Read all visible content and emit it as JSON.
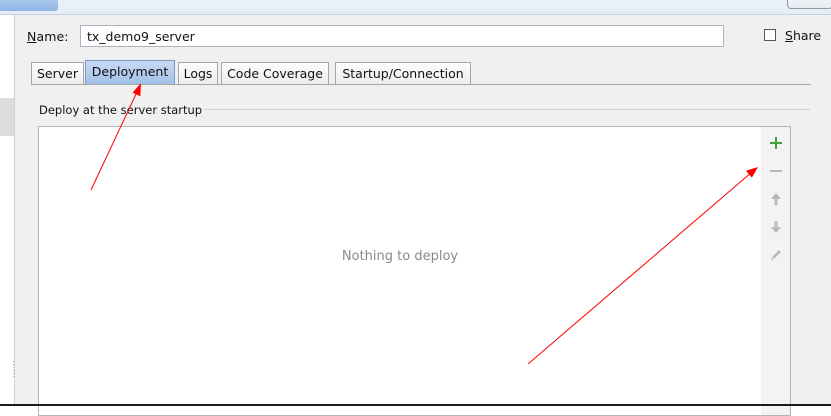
{
  "form": {
    "name_label_mnemonic": "N",
    "name_label_rest": "ame:",
    "name_value": "tx_demo9_server",
    "share_label_mnemonic": "S",
    "share_label_rest": "hare",
    "share_checked": false
  },
  "tabs": [
    {
      "label": "Server",
      "active": false
    },
    {
      "label": "Deployment",
      "active": true
    },
    {
      "label": "Logs",
      "active": false
    },
    {
      "label": "Code Coverage",
      "active": false
    },
    {
      "label": "Startup/Connection",
      "active": false
    }
  ],
  "deploy": {
    "section_title": "Deploy at the server startup",
    "empty_text": "Nothing to deploy",
    "toolbar": [
      {
        "icon": "plus-icon",
        "enabled": true
      },
      {
        "icon": "minus-icon",
        "enabled": false
      },
      {
        "icon": "arrow-up-icon",
        "enabled": false
      },
      {
        "icon": "arrow-down-icon",
        "enabled": false
      },
      {
        "icon": "pencil-icon",
        "enabled": false
      }
    ]
  },
  "colors": {
    "add_icon": "#3da03d",
    "disabled_icon": "#b9b9b9",
    "annotation_arrow": "#ff0000",
    "active_tab": "#a9c6ec"
  }
}
